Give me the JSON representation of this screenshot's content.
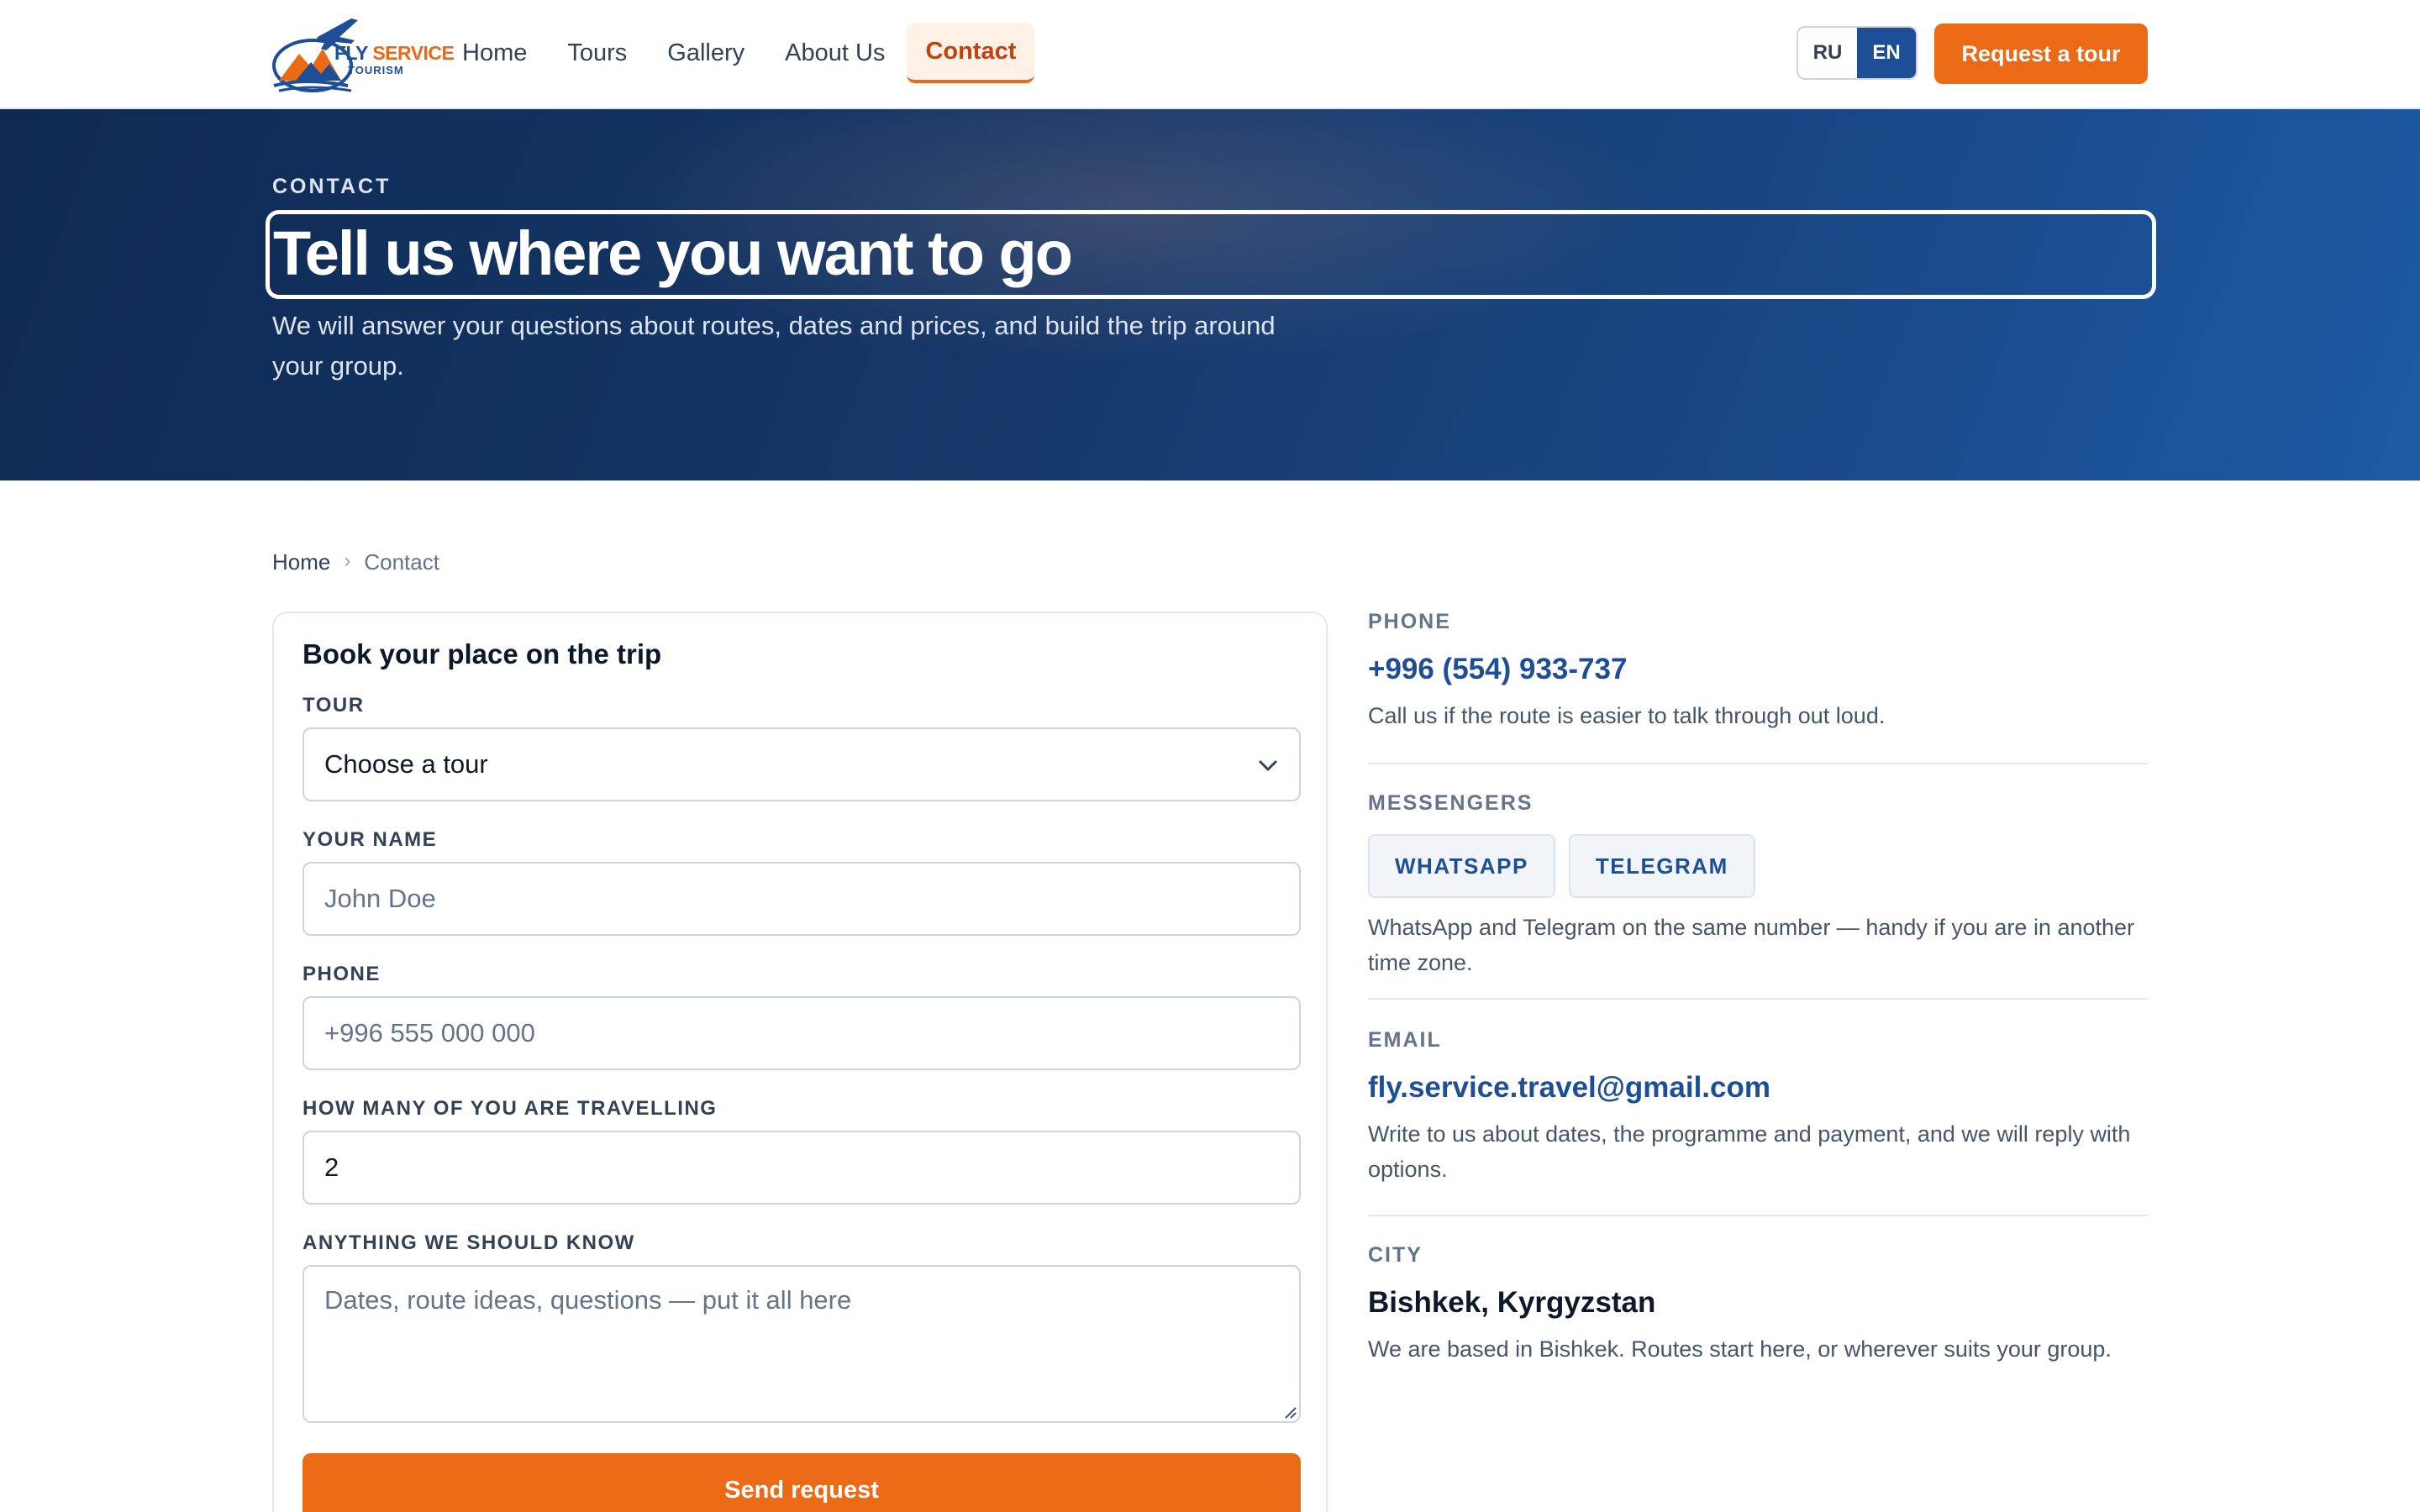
{
  "brand": {
    "name_part1": "FLY",
    "name_part2": "SERVICE",
    "name_part3": "TOURISM"
  },
  "nav": {
    "items": [
      {
        "label": "Home"
      },
      {
        "label": "Tours"
      },
      {
        "label": "Gallery"
      },
      {
        "label": "About Us"
      },
      {
        "label": "Contact",
        "active": true
      }
    ]
  },
  "lang": {
    "ru": "RU",
    "en": "EN",
    "active": "EN"
  },
  "header": {
    "cta_label": "Request a tour"
  },
  "hero": {
    "eyebrow": "CONTACT",
    "title": "Tell us where you want to go",
    "subtitle": "We will answer your questions about routes, dates and prices, and build the trip around your group."
  },
  "breadcrumb": {
    "home": "Home",
    "separator": "›",
    "current": "Contact"
  },
  "form": {
    "title": "Book your place on the trip",
    "tour": {
      "label": "TOUR",
      "value": "Choose a tour"
    },
    "name": {
      "label": "YOUR NAME",
      "placeholder": "John Doe",
      "value": ""
    },
    "phone": {
      "label": "PHONE",
      "placeholder": "+996 555 000 000",
      "value": ""
    },
    "travellers": {
      "label": "HOW MANY OF YOU ARE TRAVELLING",
      "value": "2"
    },
    "notes": {
      "label": "ANYTHING WE SHOULD KNOW",
      "placeholder": "Dates, route ideas, questions — put it all here"
    },
    "submit_label": "Send request"
  },
  "contact": {
    "phone": {
      "label": "PHONE",
      "value": "+996 (554) 933-737",
      "desc": "Call us if the route is easier to talk through out loud."
    },
    "messengers": {
      "label": "MESSENGERS",
      "whatsapp": "WHATSAPP",
      "telegram": "TELEGRAM",
      "desc": "WhatsApp and Telegram on the same number — handy if you are in another time zone."
    },
    "email": {
      "label": "EMAIL",
      "value": "fly.service.travel@gmail.com",
      "desc": "Write to us about dates, the programme and payment, and we will reply with options."
    },
    "city": {
      "label": "CITY",
      "value": "Bishkek, Kyrgyzstan",
      "desc": "We are based in Bishkek. Routes start here, or wherever suits your group."
    }
  },
  "colors": {
    "accent": "#ea6a16",
    "brand_blue": "#1e4f96",
    "hero_dark": "#0e2a52"
  },
  "icons": {
    "select": "chevron-down-icon",
    "textarea": "resize-grip-icon",
    "logo": "plane-icon"
  }
}
